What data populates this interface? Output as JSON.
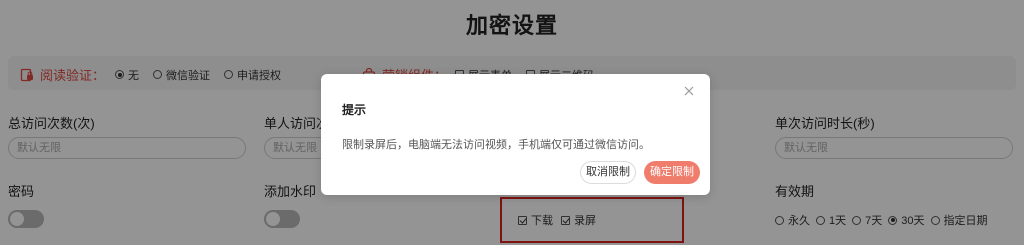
{
  "page": {
    "title": "加密设置"
  },
  "reading_verification": {
    "label": "阅读验证：",
    "icon": "book-lock-icon",
    "options": [
      "无",
      "微信验证",
      "申请授权"
    ],
    "selected": "无"
  },
  "marketing": {
    "label": "营销组件：",
    "icon": "shopping-bag-icon",
    "options": [
      "展示表单",
      "展示二维码"
    ]
  },
  "fields": {
    "total_visits": {
      "label": "总访问次数(次)",
      "placeholder": "默认无限"
    },
    "single_visits": {
      "label": "单人访问次",
      "placeholder": "默认无限"
    },
    "single_duration": {
      "label": "单次访问时长(秒)",
      "placeholder": "默认无限"
    },
    "password": {
      "label": "密码"
    },
    "watermark": {
      "label": "添加水印"
    },
    "validity": {
      "label": "有效期"
    }
  },
  "restrictions": {
    "options": [
      "下载",
      "录屏"
    ]
  },
  "validity_options": {
    "options": [
      "永久",
      "1天",
      "7天",
      "30天",
      "指定日期"
    ],
    "selected": "30天"
  },
  "dialog": {
    "title": "提示",
    "message": "限制录屏后，电脑端无法访问视频，手机端仅可通过微信访问。",
    "cancel_label": "取消限制",
    "confirm_label": "确定限制",
    "close_icon": "close-icon"
  },
  "colors": {
    "accent": "#e0473e",
    "confirm": "#f07c6c",
    "highlight_border": "#d9211a"
  }
}
